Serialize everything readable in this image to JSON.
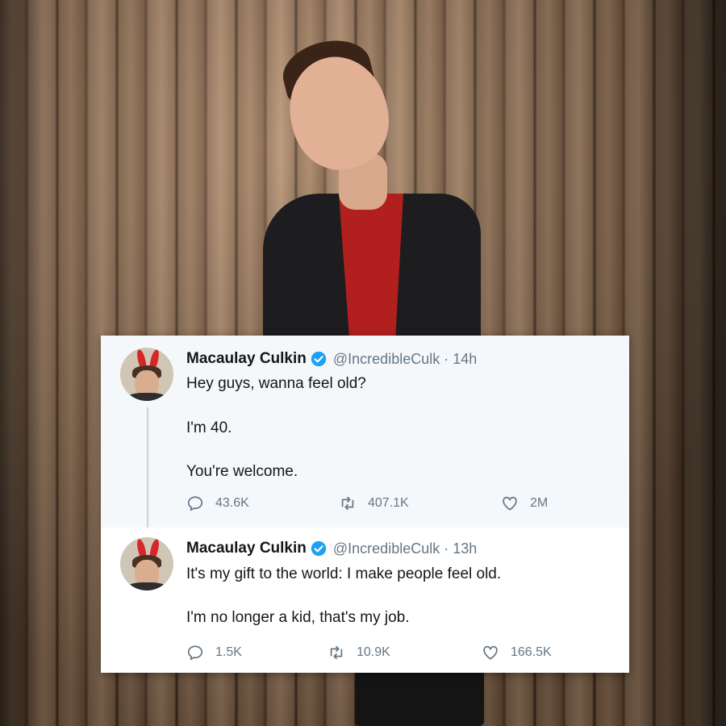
{
  "tweets": [
    {
      "name": "Macaulay Culkin",
      "handle": "@IncredibleCulk",
      "separator": "·",
      "time": "14h",
      "lines": [
        "Hey guys, wanna feel old?",
        "I'm 40.",
        "You're welcome."
      ],
      "replies": "43.6K",
      "retweets": "407.1K",
      "likes": "2M"
    },
    {
      "name": "Macaulay Culkin",
      "handle": "@IncredibleCulk",
      "separator": "·",
      "time": "13h",
      "lines": [
        "It's my gift to the world: I make people feel old.",
        "I'm no longer a kid, that's my job."
      ],
      "replies": "1.5K",
      "retweets": "10.9K",
      "likes": "166.5K"
    }
  ],
  "icons": {
    "verified": "verified-badge-icon",
    "reply": "reply-icon",
    "retweet": "retweet-icon",
    "like": "heart-icon"
  },
  "colors": {
    "verified": "#1da1f2",
    "muted": "#657786",
    "text": "#14171a"
  }
}
